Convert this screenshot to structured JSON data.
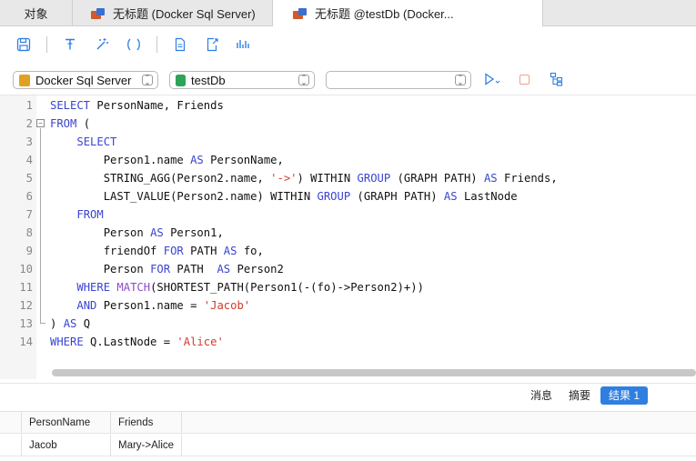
{
  "tabs": [
    {
      "label": "对象",
      "active": false
    },
    {
      "label": "无标题 (Docker Sql Server)",
      "active": false
    },
    {
      "label": "无标题 @testDb (Docker...",
      "active": true
    }
  ],
  "toolbar": {
    "icons": [
      "save-icon",
      "format-icon",
      "beautify-icon",
      "parentheses-icon",
      "document-icon",
      "export-icon",
      "chart-icon"
    ]
  },
  "connection": {
    "selected": "Docker Sql Server"
  },
  "database": {
    "selected": "testDb"
  },
  "schema": {
    "selected": ""
  },
  "editor": {
    "lines": [
      {
        "n": "1",
        "html": "<span class=\"kw\">SELECT</span> PersonName, Friends"
      },
      {
        "n": "2",
        "html": "<span class=\"kw\">FROM</span> ("
      },
      {
        "n": "3",
        "html": "    <span class=\"kw\">SELECT</span>"
      },
      {
        "n": "4",
        "html": "        Person1.name <span class=\"kw\">AS</span> PersonName,"
      },
      {
        "n": "5",
        "html": "        STRING_AGG(Person2.name, <span class=\"str\">'->'</span>) WITHIN <span class=\"kw\">GROUP</span> (GRAPH PATH) <span class=\"kw\">AS</span> Friends,"
      },
      {
        "n": "6",
        "html": "        LAST_VALUE(Person2.name) WITHIN <span class=\"kw\">GROUP</span> (GRAPH PATH) <span class=\"kw\">AS</span> LastNode"
      },
      {
        "n": "7",
        "html": "    <span class=\"kw\">FROM</span>"
      },
      {
        "n": "8",
        "html": "        Person <span class=\"kw\">AS</span> Person1,"
      },
      {
        "n": "9",
        "html": "        friendOf <span class=\"kw\">FOR</span> PATH <span class=\"kw\">AS</span> fo,"
      },
      {
        "n": "10",
        "html": "        Person <span class=\"kw\">FOR</span> PATH  <span class=\"kw\">AS</span> Person2"
      },
      {
        "n": "11",
        "html": "    <span class=\"kw\">WHERE</span> <span class=\"fn\">MATCH</span>(SHORTEST_PATH(Person1(-(fo)->Person2)+))"
      },
      {
        "n": "12",
        "html": "    <span class=\"kw\">AND</span> Person1.name = <span class=\"str\">'Jacob'</span>"
      },
      {
        "n": "13",
        "html": ") <span class=\"kw\">AS</span> Q"
      },
      {
        "n": "14",
        "html": "<span class=\"kw\">WHERE</span> Q.LastNode = <span class=\"str\">'Alice'</span>"
      }
    ]
  },
  "result_tabs": {
    "messages": "消息",
    "summary": "摘要",
    "result1": "结果 1"
  },
  "grid": {
    "columns": [
      "PersonName",
      "Friends"
    ],
    "rows": [
      [
        "Jacob",
        "Mary->Alice"
      ]
    ]
  },
  "colors": {
    "accent": "#2f7fe0",
    "keyword": "#3a44d0",
    "string": "#d43b2c",
    "function": "#8a4ccc"
  }
}
